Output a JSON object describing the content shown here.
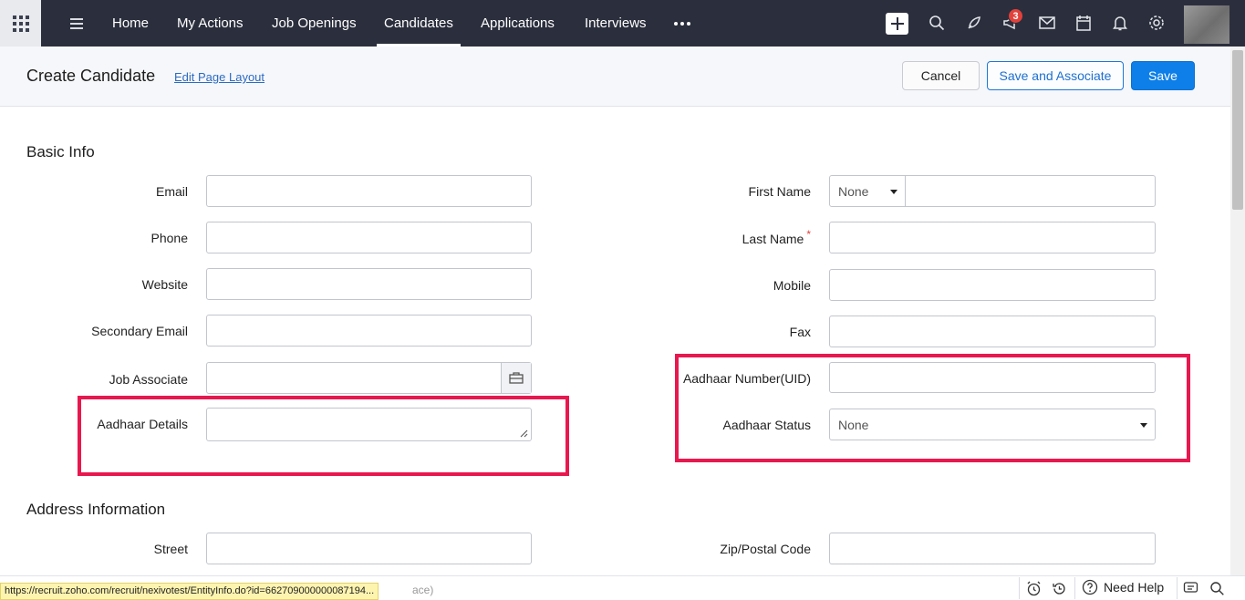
{
  "nav": {
    "items": [
      {
        "label": "Home"
      },
      {
        "label": "My Actions"
      },
      {
        "label": "Job Openings"
      },
      {
        "label": "Candidates",
        "active": true
      },
      {
        "label": "Applications"
      },
      {
        "label": "Interviews"
      }
    ],
    "notification_count": "3",
    "icons": [
      "apps-grid-icon",
      "hamburger-icon",
      "more-icon",
      "plus-icon",
      "search-icon",
      "rocket-icon",
      "announcement-icon",
      "mail-icon",
      "calendar-icon",
      "bell-icon",
      "gear-icon"
    ]
  },
  "header": {
    "title": "Create Candidate",
    "edit_layout": "Edit Page Layout",
    "cancel": "Cancel",
    "save_associate": "Save and Associate",
    "save": "Save"
  },
  "basic_info": {
    "title": "Basic Info",
    "email": "Email",
    "phone": "Phone",
    "website": "Website",
    "secondary_email": "Secondary Email",
    "job_associate": "Job Associate",
    "aadhaar_details": "Aadhaar Details",
    "first_name": "First Name",
    "salutation_value": "None",
    "last_name": "Last Name",
    "required_mark": "*",
    "mobile": "Mobile",
    "fax": "Fax",
    "aadhaar_number": "Aadhaar Number(UID)",
    "aadhaar_status": "Aadhaar Status",
    "aadhaar_status_value": "None"
  },
  "address": {
    "title": "Address Information",
    "street": "Street",
    "zip": "Zip/Postal Code"
  },
  "footer": {
    "url": "https://recruit.zoho.com/recruit/nexivotest/EntityInfo.do?id=662709000000087194...",
    "obscured_text": "ace)",
    "need_help": "Need Help"
  },
  "colors": {
    "topbar": "#2b2f3d",
    "primary": "#0e7fe8",
    "highlight": "#e8184f",
    "badge": "#e2413b"
  }
}
